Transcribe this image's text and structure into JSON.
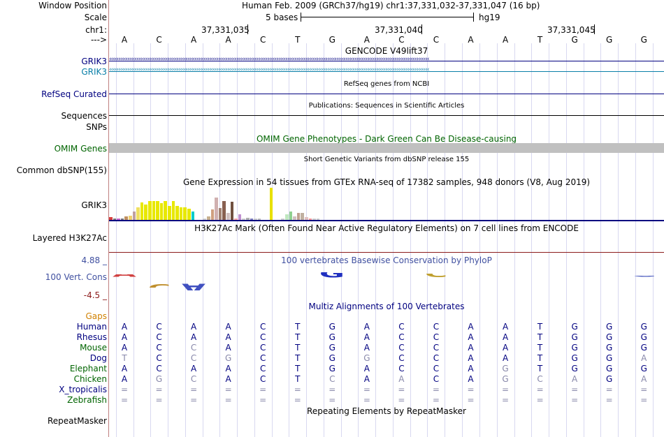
{
  "colors": {
    "dark_blue": "#000080",
    "teal": "#0a7fa8",
    "omim_green": "#006400",
    "conservation_blue": "#4050a0",
    "gaps_orange": "#d08000",
    "negative_red": "#8b1a1a",
    "omim_bar": "#c0c0c0"
  },
  "labels": {
    "window_position": "Window Position",
    "scale": "Scale",
    "chr": "chr1:",
    "arrow": "--->",
    "grik3_a": "GRIK3",
    "grik3_b": "GRIK3",
    "refseq": "RefSeq Curated",
    "sequences": "Sequences",
    "snps": "SNPs",
    "omim": "OMIM Genes",
    "common_dbsnp": "Common dbSNP(155)",
    "gtex_gene": "GRIK3",
    "h3k27ac": "Layered H3K27Ac",
    "cons_max": "4.88 _",
    "cons_label": "100 Vert. Cons",
    "cons_min": "-4.5 _",
    "gaps": "Gaps",
    "repeatmasker": "RepeatMasker"
  },
  "header": {
    "position": "Human Feb. 2009 (GRCh37/hg19)   chr1:37,331,032-37,331,047 (16 bp)",
    "scale_text": "5 bases",
    "assembly": "hg19",
    "coords": [
      "37,331,035",
      "37,331,040",
      "37,331,045"
    ]
  },
  "sequence": [
    "A",
    "C",
    "A",
    "A",
    "C",
    "T",
    "G",
    "A",
    "C",
    "C",
    "A",
    "A",
    "T",
    "G",
    "G",
    "G"
  ],
  "tracks": {
    "gencode": "GENCODE V49lift37",
    "refseq_title": "RefSeq genes from NCBI",
    "publications": "Publications: Sequences in Scientific Articles",
    "omim_title": "OMIM Gene Phenotypes - Dark Green Can Be Disease-causing",
    "dbsnp_title": "Short Genetic Variants from dbSNP release 155",
    "gtex_title": "Gene Expression in 54 tissues from GTEx RNA-seq of 17382 samples, 948 donors (V8, Aug 2019)",
    "h3k27ac_title": "H3K27Ac Mark (Often Found Near Active Regulatory Elements) on 7 cell lines from ENCODE",
    "cons_title": "100 vertebrates Basewise Conservation by PhyloP",
    "multiz_title": "Multiz Alignments of 100 Vertebrates",
    "repeat_title": "Repeating Elements by RepeatMasker"
  },
  "gtex_bars": [
    {
      "value": 4,
      "color": "#d93f3f"
    },
    {
      "value": 2,
      "color": "#7a7a7a"
    },
    {
      "value": 2,
      "color": "#cc66cc"
    },
    {
      "value": 2,
      "color": "#7a7a7a"
    },
    {
      "value": 5,
      "color": "#c09060"
    },
    {
      "value": 6,
      "color": "#f0d070"
    },
    {
      "value": 12,
      "color": "#c0a0a0"
    },
    {
      "value": 18,
      "color": "#f0e060"
    },
    {
      "value": 25,
      "color": "#e8e800"
    },
    {
      "value": 22,
      "color": "#e8e800"
    },
    {
      "value": 27,
      "color": "#e8e800"
    },
    {
      "value": 27,
      "color": "#e8e800"
    },
    {
      "value": 27,
      "color": "#e8e800"
    },
    {
      "value": 24,
      "color": "#e8e800"
    },
    {
      "value": 27,
      "color": "#e8e800"
    },
    {
      "value": 20,
      "color": "#e8e800"
    },
    {
      "value": 27,
      "color": "#e8e800"
    },
    {
      "value": 20,
      "color": "#e8e800"
    },
    {
      "value": 18,
      "color": "#e8e800"
    },
    {
      "value": 18,
      "color": "#e8e800"
    },
    {
      "value": 16,
      "color": "#e8e800"
    },
    {
      "value": 12,
      "color": "#00cccc"
    },
    {
      "value": 0,
      "color": "#ffffff"
    },
    {
      "value": 0,
      "color": "#ffffff"
    },
    {
      "value": 2,
      "color": "#d0d0d0"
    },
    {
      "value": 5,
      "color": "#c8b090"
    },
    {
      "value": 15,
      "color": "#d0a080"
    },
    {
      "value": 32,
      "color": "#d0b0b0"
    },
    {
      "value": 17,
      "color": "#a08070"
    },
    {
      "value": 27,
      "color": "#886050"
    },
    {
      "value": 10,
      "color": "#d0c0c0"
    },
    {
      "value": 26,
      "color": "#705040"
    },
    {
      "value": 2,
      "color": "#ffaaaa"
    },
    {
      "value": 8,
      "color": "#c090d0"
    },
    {
      "value": 2,
      "color": "#d0d0d0"
    },
    {
      "value": 3,
      "color": "#b0b0b0"
    },
    {
      "value": 2,
      "color": "#8080c0"
    },
    {
      "value": 2,
      "color": "#d0d0d0"
    },
    {
      "value": 2,
      "color": "#c0c0c0"
    },
    {
      "value": 0,
      "color": "#ffffff"
    },
    {
      "value": 0,
      "color": "#ffffff"
    },
    {
      "value": 46,
      "color": "#e8e000"
    },
    {
      "value": 0,
      "color": "#ffffff"
    },
    {
      "value": 0,
      "color": "#ffffff"
    },
    {
      "value": 2,
      "color": "#d0d0d0"
    },
    {
      "value": 8,
      "color": "#bfe8bf"
    },
    {
      "value": 12,
      "color": "#90d090"
    },
    {
      "value": 5,
      "color": "#d0c0c0"
    },
    {
      "value": 10,
      "color": "#c0a090"
    },
    {
      "value": 10,
      "color": "#c0b0a0"
    },
    {
      "value": 4,
      "color": "#e0c0c0"
    },
    {
      "value": 2,
      "color": "#ff9999"
    },
    {
      "value": 2,
      "color": "#d0d0d0"
    },
    {
      "value": 2,
      "color": "#d0d0d0"
    }
  ],
  "conservation": [
    {
      "base": "A",
      "value": 0.8,
      "color": "#d04040"
    },
    {
      "base": "C",
      "value": -0.9,
      "color": "#c09030"
    },
    {
      "base": "A",
      "value": -1.3,
      "color": "#4050c0"
    },
    {
      "base": "",
      "value": 0,
      "color": "#ffffff"
    },
    {
      "base": "",
      "value": 0,
      "color": "#ffffff"
    },
    {
      "base": "T",
      "value": 0.2,
      "color": "#40a040"
    },
    {
      "base": "G",
      "value": 1.1,
      "color": "#2030c0"
    },
    {
      "base": "A",
      "value": 0.2,
      "color": "#d04040"
    },
    {
      "base": "C",
      "value": 0.5,
      "color": "#c0c060"
    },
    {
      "base": "C",
      "value": 0.9,
      "color": "#c0a030"
    },
    {
      "base": "A",
      "value": 0.5,
      "color": "#d04040"
    },
    {
      "base": "",
      "value": 0,
      "color": "#ffffff"
    },
    {
      "base": "T",
      "value": -0.2,
      "color": "#40a040"
    },
    {
      "base": "G",
      "value": 0.3,
      "color": "#5060c0"
    },
    {
      "base": "G",
      "value": 0.3,
      "color": "#5060c0"
    },
    {
      "base": "G",
      "value": 0.6,
      "color": "#5060c0"
    }
  ],
  "species": [
    {
      "name": "Human",
      "color": "#000080",
      "bases": [
        "A",
        "C",
        "A",
        "A",
        "C",
        "T",
        "G",
        "A",
        "C",
        "C",
        "A",
        "A",
        "T",
        "G",
        "G",
        "G"
      ],
      "mismatch": [
        0,
        0,
        0,
        0,
        0,
        0,
        0,
        0,
        0,
        0,
        0,
        0,
        0,
        0,
        0,
        0
      ]
    },
    {
      "name": "Rhesus",
      "color": "#000080",
      "bases": [
        "A",
        "C",
        "A",
        "A",
        "C",
        "T",
        "G",
        "A",
        "C",
        "C",
        "A",
        "A",
        "T",
        "G",
        "G",
        "G"
      ],
      "mismatch": [
        0,
        0,
        0,
        0,
        0,
        0,
        0,
        0,
        0,
        0,
        0,
        0,
        0,
        0,
        0,
        0
      ]
    },
    {
      "name": "Mouse",
      "color": "#006400",
      "bases": [
        "A",
        "C",
        "C",
        "A",
        "C",
        "T",
        "G",
        "A",
        "C",
        "C",
        "A",
        "A",
        "T",
        "G",
        "G",
        "G"
      ],
      "mismatch": [
        0,
        0,
        1,
        0,
        0,
        0,
        0,
        0,
        0,
        0,
        0,
        0,
        0,
        0,
        0,
        0
      ]
    },
    {
      "name": "Dog",
      "color": "#000080",
      "bases": [
        "T",
        "C",
        "C",
        "G",
        "C",
        "T",
        "G",
        "G",
        "C",
        "C",
        "A",
        "A",
        "T",
        "G",
        "G",
        "A"
      ],
      "mismatch": [
        1,
        0,
        1,
        1,
        0,
        0,
        0,
        1,
        0,
        0,
        0,
        0,
        0,
        0,
        0,
        1
      ]
    },
    {
      "name": "Elephant",
      "color": "#006400",
      "bases": [
        "A",
        "C",
        "A",
        "A",
        "C",
        "T",
        "G",
        "A",
        "C",
        "C",
        "A",
        "G",
        "T",
        "G",
        "G",
        "G"
      ],
      "mismatch": [
        0,
        0,
        0,
        0,
        0,
        0,
        0,
        0,
        0,
        0,
        0,
        1,
        0,
        0,
        0,
        0
      ]
    },
    {
      "name": "Chicken",
      "color": "#006400",
      "bases": [
        "A",
        "G",
        "C",
        "A",
        "C",
        "T",
        "C",
        "A",
        "A",
        "C",
        "A",
        "G",
        "C",
        "A",
        "G",
        "A"
      ],
      "mismatch": [
        0,
        1,
        1,
        0,
        0,
        0,
        1,
        0,
        1,
        0,
        0,
        1,
        1,
        1,
        0,
        1
      ]
    },
    {
      "name": "X_tropicalis",
      "color": "#000080",
      "bases": [
        "=",
        "=",
        "=",
        "=",
        "=",
        "=",
        "=",
        "=",
        "=",
        "=",
        "=",
        "=",
        "=",
        "=",
        "=",
        "="
      ],
      "mismatch": [
        1,
        1,
        1,
        1,
        1,
        1,
        1,
        1,
        1,
        1,
        1,
        1,
        1,
        1,
        1,
        1
      ]
    },
    {
      "name": "Zebrafish",
      "color": "#006400",
      "bases": [
        "=",
        "=",
        "=",
        "=",
        "=",
        "=",
        "=",
        "=",
        "=",
        "=",
        "=",
        "=",
        "=",
        "=",
        "=",
        "="
      ],
      "mismatch": [
        1,
        1,
        1,
        1,
        1,
        1,
        1,
        1,
        1,
        1,
        1,
        1,
        1,
        1,
        1,
        1
      ]
    }
  ]
}
